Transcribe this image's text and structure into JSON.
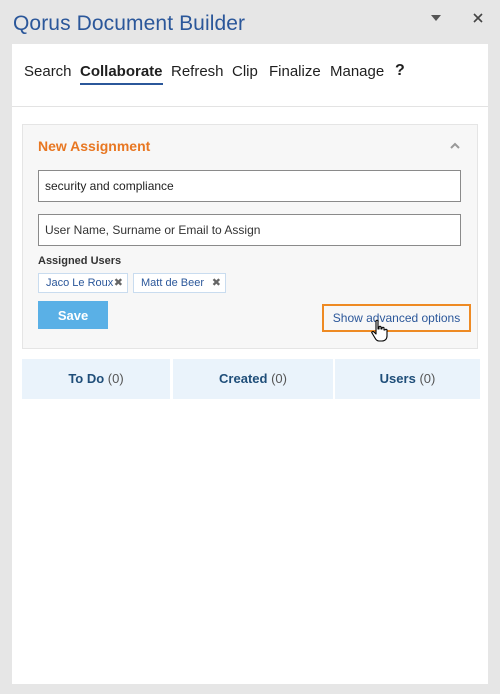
{
  "window": {
    "title": "Qorus Document Builder",
    "dropdown_icon": "triangle-down-icon",
    "close_icon": "close-icon"
  },
  "tabs": [
    {
      "label": "Search"
    },
    {
      "label": "Collaborate",
      "active": true
    },
    {
      "label": "Refresh"
    },
    {
      "label": "Clip"
    },
    {
      "label": "Finalize"
    },
    {
      "label": "Manage"
    },
    {
      "label": "?"
    }
  ],
  "assignment": {
    "title": "New Assignment",
    "collapse_icon": "chevron-up-icon",
    "subject_value": "security and compliance",
    "assignee_placeholder": "User Name, Surname or Email to Assign",
    "assigned_users_label": "Assigned Users",
    "assigned_users": [
      {
        "name": "Jaco Le Roux",
        "remove_icon": "remove-x-icon"
      },
      {
        "name": "Matt de Beer",
        "remove_icon": "remove-x-icon"
      }
    ],
    "save_label": "Save",
    "advanced_label": "Show advanced options"
  },
  "summary": [
    {
      "label": "To Do",
      "count": "(0)"
    },
    {
      "label": "Created",
      "count": "(0)"
    },
    {
      "label": "Users",
      "count": "(0)"
    }
  ],
  "colors": {
    "brand_blue": "#2b579a",
    "accent_orange": "#e87722",
    "save_button": "#5ab0e6",
    "highlight_border": "#ee8a23"
  }
}
